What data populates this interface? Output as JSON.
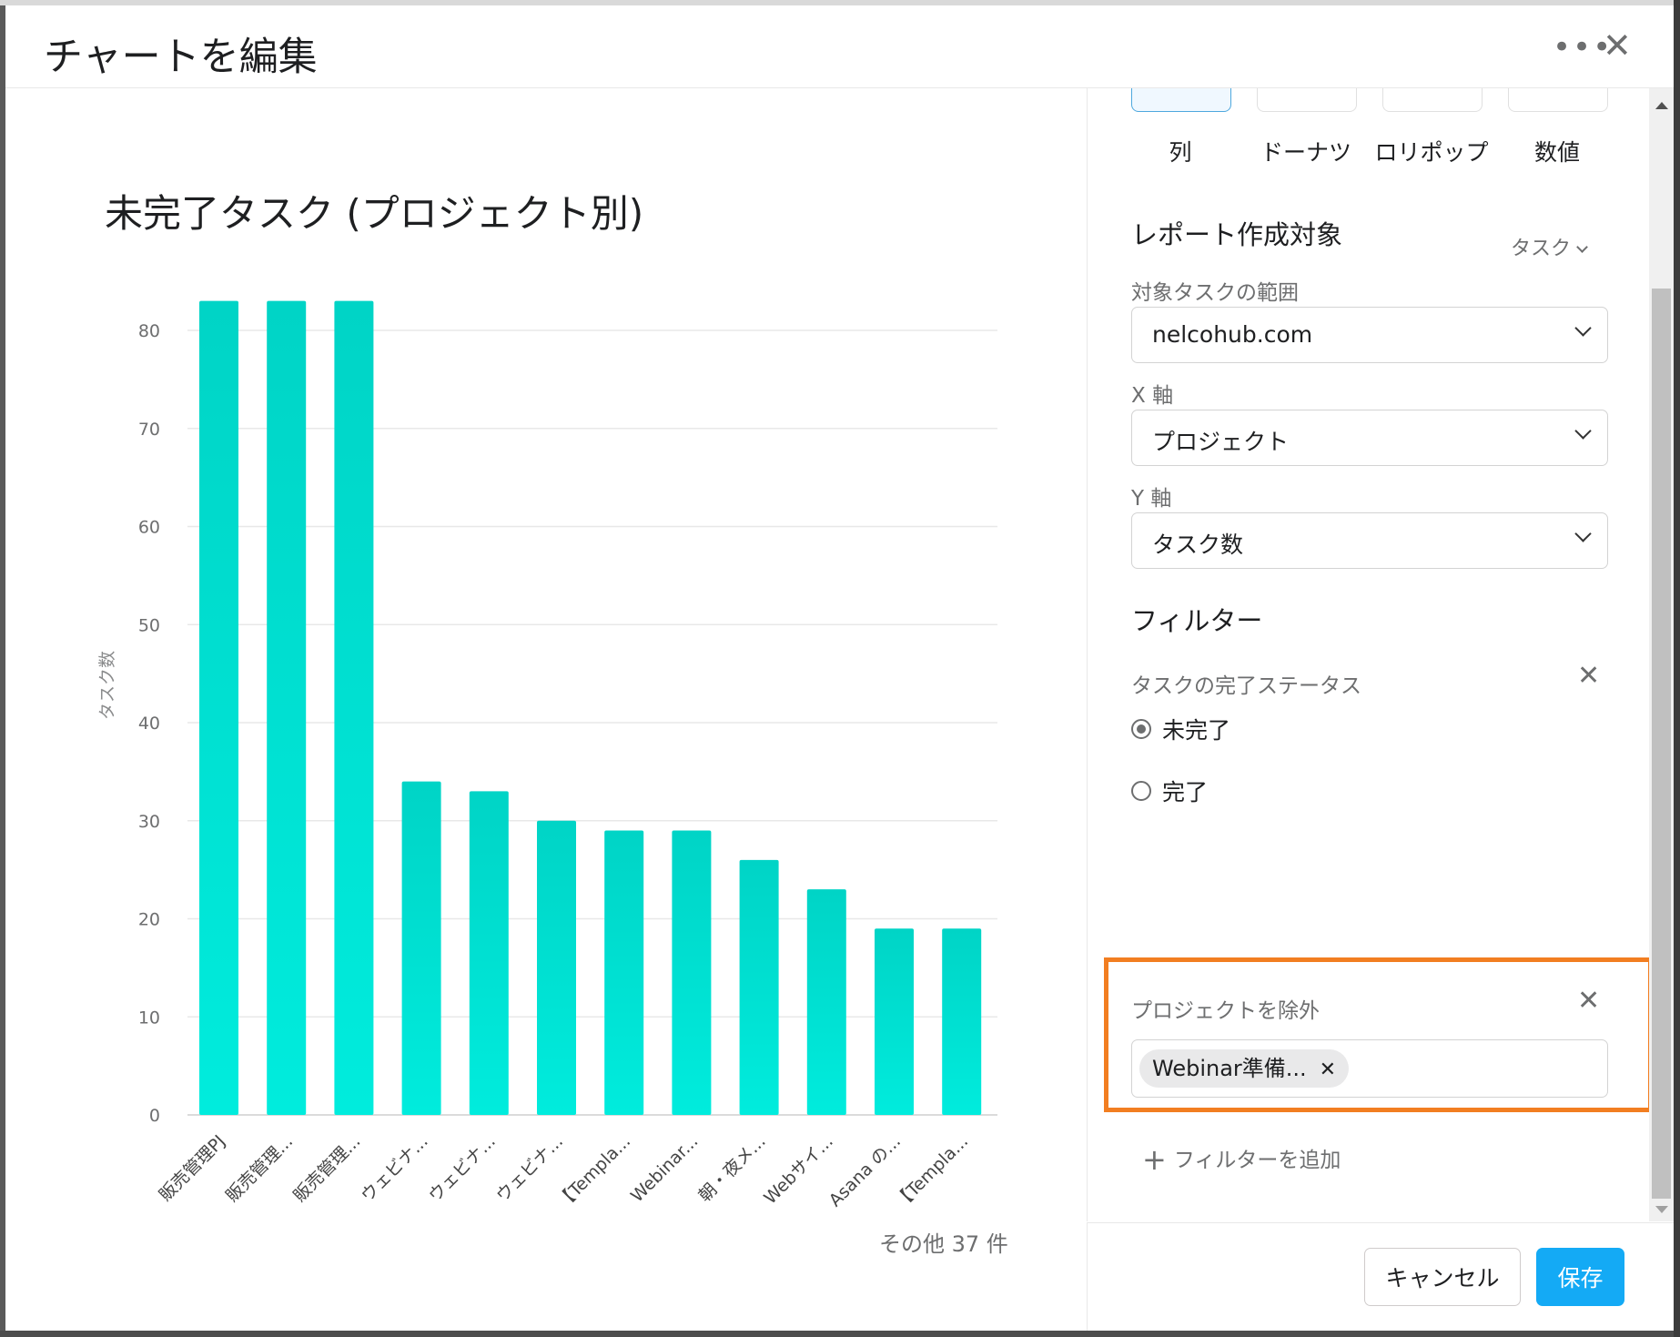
{
  "dialog": {
    "title": "チャートを編集",
    "more_icon": "more-horizontal-icon",
    "close_icon": "close-icon"
  },
  "chart_types": [
    {
      "label": "列",
      "selected": true
    },
    {
      "label": "ドーナツ",
      "selected": false
    },
    {
      "label": "ロリポップ",
      "selected": false
    },
    {
      "label": "数値",
      "selected": false
    }
  ],
  "settings": {
    "report_target_label": "レポート作成対象",
    "report_target_value": "タスク",
    "scope_label": "対象タスクの範囲",
    "scope_value": "nelcohub.com",
    "x_axis_label": "X 軸",
    "x_axis_value": "プロジェクト",
    "y_axis_label": "Y 軸",
    "y_axis_value": "タスク数"
  },
  "filters": {
    "heading": "フィルター",
    "status_label": "タスクの完了ステータス",
    "status_options": [
      {
        "label": "未完了",
        "checked": true
      },
      {
        "label": "完了",
        "checked": false
      }
    ],
    "exclude_label": "プロジェクトを除外",
    "exclude_chips": [
      "Webinar準備..."
    ],
    "add_filter": "フィルターを追加"
  },
  "footer": {
    "cancel": "キャンセル",
    "save": "保存"
  },
  "colors": {
    "bar_top": "#00d4c6",
    "bar_bottom": "#00ecdd",
    "primary_button": "#14aaf5",
    "highlight": "#f27e21"
  },
  "chart_data": {
    "type": "bar",
    "title": "未完了タスク (プロジェクト別)",
    "xlabel": "",
    "ylabel": "タスク数",
    "ylim": [
      0,
      80
    ],
    "yticks": [
      0,
      10,
      20,
      30,
      40,
      50,
      60,
      70,
      80
    ],
    "categories": [
      "販売管理PJ",
      "販売管理...",
      "販売管理...",
      "ウェビナ...",
      "ウェビナ...",
      "ウェビナ...",
      "【Templa...",
      "Webinar...",
      "朝・夜メ...",
      "Webサイ...",
      "Asana の...",
      "【Templa..."
    ],
    "values": [
      83,
      83,
      83,
      34,
      33,
      30,
      29,
      29,
      26,
      23,
      19,
      19
    ],
    "others_note": "その他 37 件"
  }
}
